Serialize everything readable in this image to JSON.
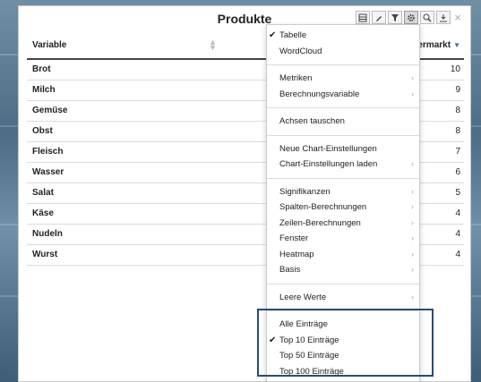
{
  "panel": {
    "title": "Produkte"
  },
  "toolbar": {
    "close_label": "×"
  },
  "table": {
    "header_variable": "Variable",
    "header_value": "permarkt",
    "rows": [
      {
        "label": "Brot",
        "value": "10"
      },
      {
        "label": "Milch",
        "value": "9"
      },
      {
        "label": "Gemüse",
        "value": "8"
      },
      {
        "label": "Obst",
        "value": "8"
      },
      {
        "label": "Fleisch",
        "value": "7"
      },
      {
        "label": "Wasser",
        "value": "6"
      },
      {
        "label": "Salat",
        "value": "5"
      },
      {
        "label": "Käse",
        "value": "4"
      },
      {
        "label": "Nudeln",
        "value": "4"
      },
      {
        "label": "Wurst",
        "value": "4"
      }
    ]
  },
  "menu": {
    "view": [
      {
        "label": "Tabelle",
        "checked": true
      },
      {
        "label": "WordCloud"
      }
    ],
    "metrics": [
      {
        "label": "Metriken"
      },
      {
        "label": "Berechnungsvariable"
      }
    ],
    "axes": [
      {
        "label": "Achsen tauschen"
      }
    ],
    "chart_settings": [
      {
        "label": "Neue Chart-Einstellungen"
      },
      {
        "label": "Chart-Einstellungen laden"
      }
    ],
    "analysis": [
      {
        "label": "Signifikanzen"
      },
      {
        "label": "Spalten-Berechnungen"
      },
      {
        "label": "Zeilen-Berechnungen"
      },
      {
        "label": "Fenster"
      },
      {
        "label": "Heatmap"
      },
      {
        "label": "Basis"
      }
    ],
    "empty": [
      {
        "label": "Leere Werte"
      }
    ],
    "entries": [
      {
        "label": "Alle Einträge"
      },
      {
        "label": "Top 10 Einträge",
        "checked": true
      },
      {
        "label": "Top 50 Einträge"
      },
      {
        "label": "Top 100 Einträge"
      }
    ],
    "check_glyph": "✔",
    "submenu_glyph": "›"
  },
  "colors": {
    "highlight_border": "#2a4a7c",
    "sort_arrow": "#4a6da8"
  }
}
